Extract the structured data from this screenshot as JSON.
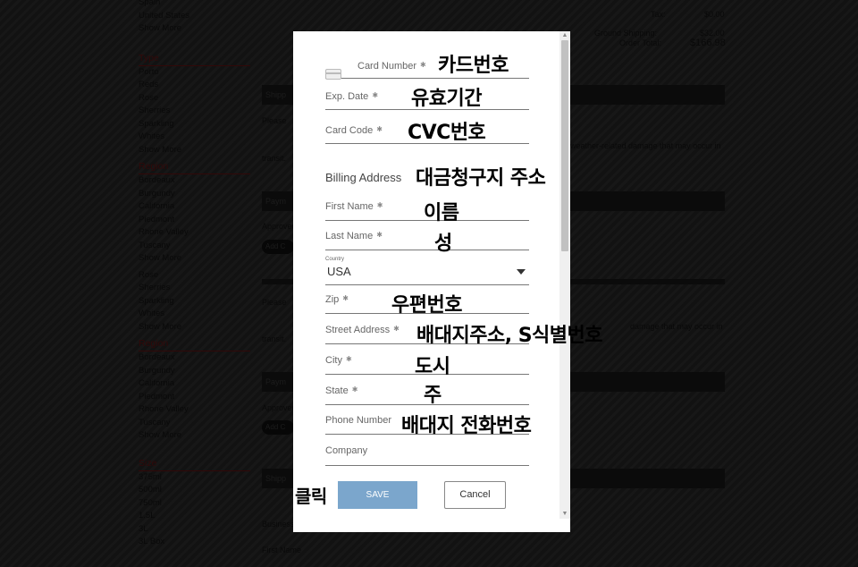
{
  "background": {
    "sidebar_top": [
      "Spain",
      "United States",
      "Show More"
    ],
    "sidebar_groups": [
      {
        "heading": "Type",
        "items": [
          "Porto",
          "Reds",
          "Rose",
          "Sherries",
          "Sparkling",
          "Whites",
          "Show More"
        ]
      },
      {
        "heading": "Region",
        "items": [
          "Bordeaux",
          "Burgundy",
          "California",
          "Piedmont",
          "Rhone Valley",
          "Tuscany",
          "Show More"
        ]
      }
    ],
    "sidebar_mid": [
      "Rose",
      "Sherries",
      "Sparkling",
      "Whites",
      "Show More"
    ],
    "sidebar_groups2": [
      {
        "heading": "Region",
        "items": [
          "Bordeaux",
          "Burgundy",
          "California",
          "Piedmont",
          "Rhone Valley",
          "Tuscany",
          "Show More"
        ]
      },
      {
        "heading": "Size",
        "items": [
          "375ml",
          "500ml",
          "750ml",
          "1.5L",
          "3L",
          "3L Box"
        ]
      }
    ],
    "totals": {
      "tax_label": "Tax:",
      "tax_value": "$0.00",
      "shipping_label": "Ground Shipping:",
      "shipping_value": "$32.00",
      "order_label": "Order Total:",
      "order_value": "$166.98"
    },
    "section_heads": [
      "Shipp",
      "Paym",
      "Paym",
      "Shipp"
    ],
    "snippets": {
      "please": "Please",
      "please2": "Please",
      "weather": "weather-related damage that may occur in",
      "weather2": "damage that may occur in",
      "transit": "transit.",
      "transit2": "transit.",
      "approved": "Approved",
      "approved2": "Approved",
      "add": "Add C",
      "add2": "Add C",
      "business": "Business",
      "firstname": "First Name"
    }
  },
  "modal": {
    "fields": [
      {
        "label": "Card Number",
        "required": true
      },
      {
        "label": "Exp. Date",
        "required": true
      },
      {
        "label": "Card Code",
        "required": true
      },
      {
        "label": "First Name",
        "required": true
      },
      {
        "label": "Last Name",
        "required": true
      },
      {
        "label": "Zip",
        "required": true
      },
      {
        "label": "Street Address",
        "required": true
      },
      {
        "label": "City",
        "required": true
      },
      {
        "label": "State",
        "required": true
      },
      {
        "label": "Phone Number",
        "required": false
      },
      {
        "label": "Company",
        "required": false
      }
    ],
    "billing_title": "Billing Address",
    "country_label": "Country",
    "country_value": "USA",
    "required_mark": "✱",
    "save_label": "SAVE",
    "cancel_label": "Cancel"
  },
  "annotations": {
    "card_number": "카드번호",
    "exp_date": "유효기간",
    "card_code": "CVC번호",
    "billing": "대금청구지 주소",
    "first_name": "이름",
    "last_name": "성",
    "zip": "우편번호",
    "street": "배대지주소, S식별번호",
    "city": "도시",
    "state": "주",
    "phone": "배대지 전화번호",
    "click": "클릭"
  }
}
